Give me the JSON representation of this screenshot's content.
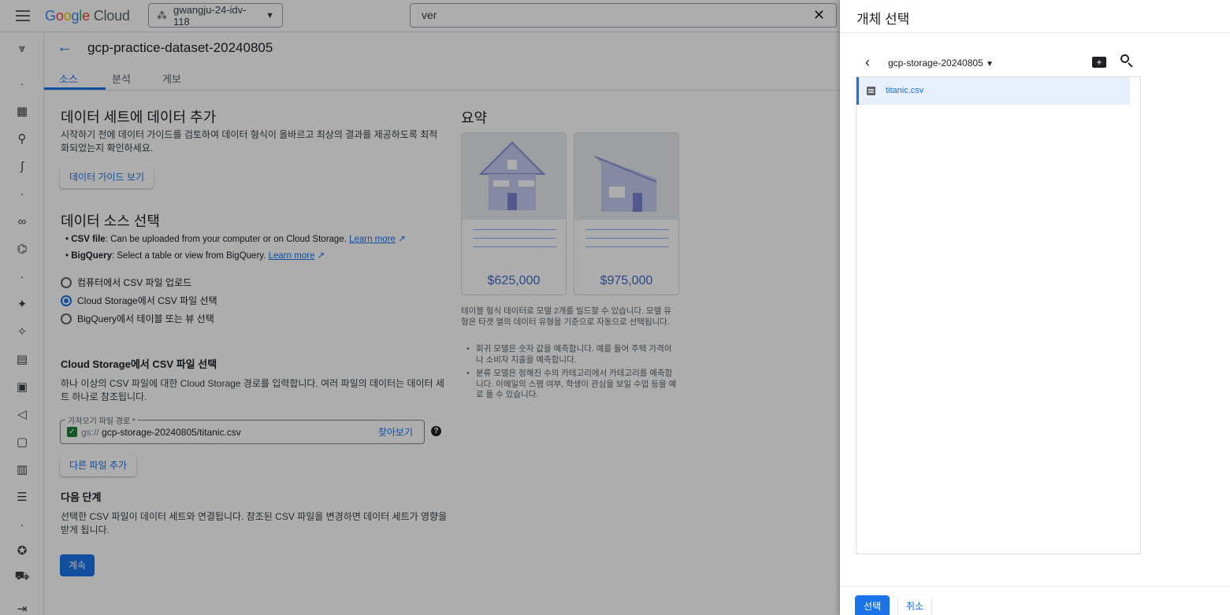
{
  "header": {
    "logo_google": "Google",
    "logo_cloud": "Cloud",
    "project": "gwangju-24-idv-118",
    "search_value": "ver"
  },
  "page": {
    "dataset_title": "gcp-practice-dataset-20240805",
    "tabs": [
      {
        "label": "소스",
        "active": true
      },
      {
        "label": "분석",
        "active": false
      },
      {
        "label": "게보",
        "active": false
      }
    ]
  },
  "add_data": {
    "heading": "데이터 세트에 데이터 추가",
    "description_line1": "시작하기 전에 데이터 가이드를 검토하여 데이터 형식이 올바르고 최상의 결과를 제공하도록 최적",
    "description_line2": "화되었는지 확인하세요.",
    "guide_button": "데이터 가이드 보기"
  },
  "source_select": {
    "heading": "데이터 소스 선택",
    "bullets": [
      {
        "bold": "CSV file",
        "text": ": Can be uploaded from your computer or on Cloud Storage.",
        "link": "Learn more"
      },
      {
        "bold": "BigQuery",
        "text": ": Select a table or view from BigQuery.",
        "link": "Learn more"
      }
    ],
    "options": [
      {
        "label": "컴퓨터에서 CSV 파일 업로드",
        "selected": false
      },
      {
        "label": "Cloud Storage에서 CSV 파일 선택",
        "selected": true
      },
      {
        "label": "BigQuery에서 테이블 또는 뷰 선택",
        "selected": false
      }
    ]
  },
  "gcs_select": {
    "heading": "Cloud Storage에서 CSV 파일 선택",
    "description_line1": "하나 이상의 CSV 파일에 대한 Cloud Storage 경로를 입력합니다. 여러 파일의 데이터는 데이터 세",
    "description_line2": "트 하나로 참조됩니다.",
    "field_label": "가져오기 파일 경로 *",
    "field_prefix": "gs://",
    "field_value": "gcp-storage-20240805/titanic.csv",
    "browse": "찾아보기",
    "help_icon": "?",
    "add_button": "다른 파일 추가"
  },
  "next_steps": {
    "heading": "다음 단계",
    "description_line1": "선택한 CSV 파일이 데이터 세트와 연결됩니다. 참조된 CSV 파일을 변경하면 데이터 세트가 영향을",
    "description_line2": "받게 됩니다.",
    "continue_button": "계속"
  },
  "summary": {
    "heading": "요약",
    "card1_price": "$625,000",
    "card2_price": "$975,000",
    "paragraph": "테이블 형식 데이터로 모델 2개를 빌드할 수 있습니다. 모델 유형은 타겟 열의 데이터 유형을 기준으로 자동으로 선택됩니다.",
    "items": [
      "회귀 모델은 숫자 값을 예측합니다. 예를 들어 주택 가격이나 소비자 지출을 예측합니다.",
      "분류 모델은 정해진 수의 카테고리에서 카테고리를 예측합니다. 이메일의 스팸 여부, 학생이 관심을 보일 수업 등을 예로 들 수 있습니다."
    ]
  },
  "panel": {
    "title": "개체 선택",
    "bucket": "gcp-storage-20240805",
    "files": [
      {
        "name": "titanic.csv",
        "selected": true
      }
    ],
    "select_button": "선택",
    "cancel_button": "취소"
  },
  "colors": {
    "accent": "#1a73e8",
    "scrim": "rgba(0,0,0,0.32)"
  }
}
